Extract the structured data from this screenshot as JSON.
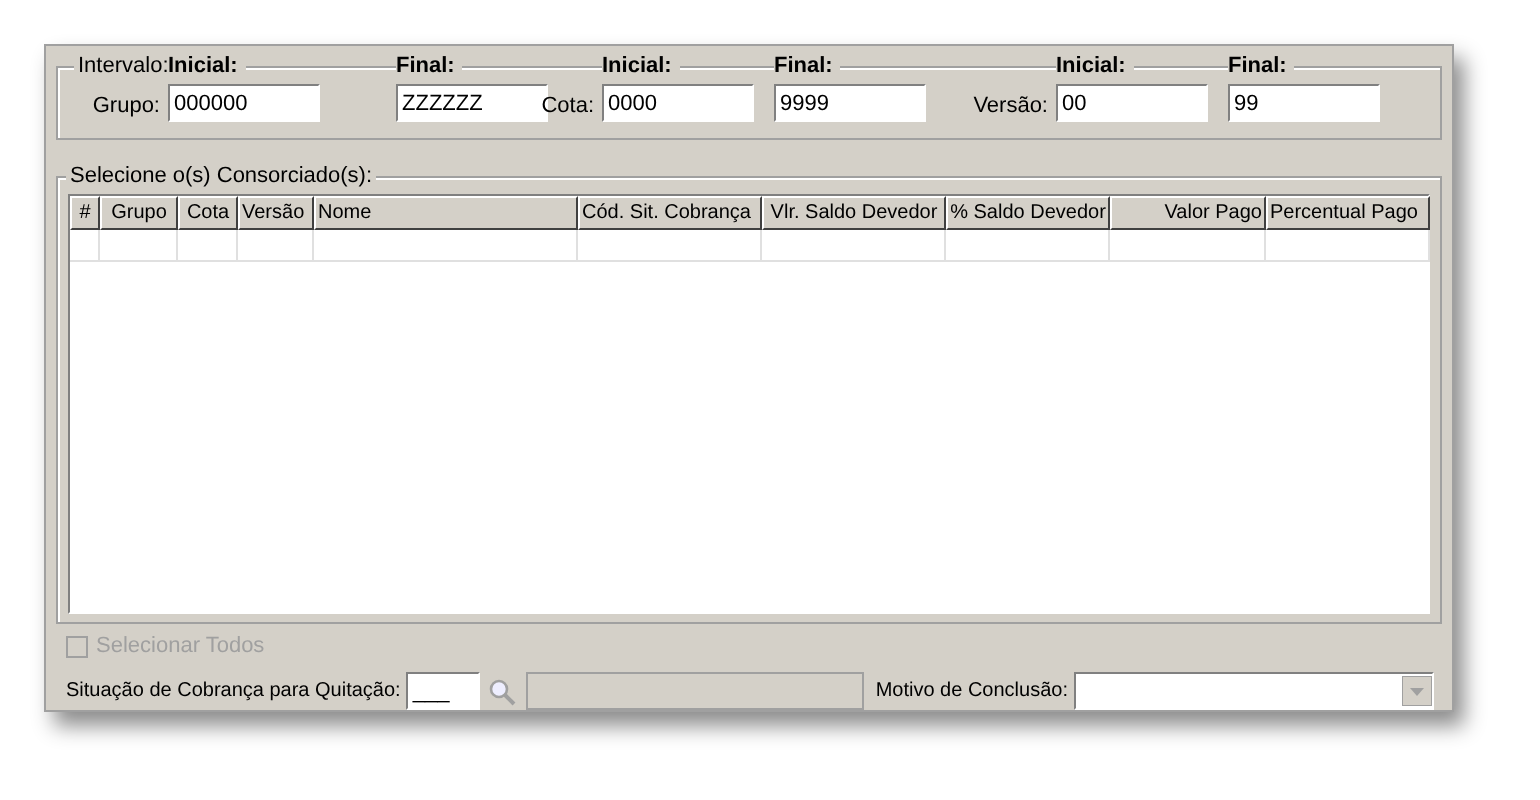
{
  "interval": {
    "legend": "Intervalo:",
    "fields": [
      {
        "label": "Grupo:",
        "start_heading": "Inicial:",
        "start_value": "000000",
        "end_heading": "Final:",
        "end_value": "ZZZZZZ"
      },
      {
        "label": "Cota:",
        "start_heading": "Inicial:",
        "start_value": "0000",
        "end_heading": "Final:",
        "end_value": "9999"
      },
      {
        "label": "Versão:",
        "start_heading": "Inicial:",
        "start_value": "00",
        "end_heading": "Final:",
        "end_value": "99"
      }
    ]
  },
  "consorciados": {
    "legend": "Selecione o(s) Consorciado(s):",
    "columns": [
      {
        "label": "#"
      },
      {
        "label": "Grupo"
      },
      {
        "label": "Cota"
      },
      {
        "label": "Versão"
      },
      {
        "label": "Nome"
      },
      {
        "label": "Cód. Sit. Cobrança"
      },
      {
        "label": "Vlr. Saldo Devedor"
      },
      {
        "label": "% Saldo Devedor"
      },
      {
        "label": "Valor Pago"
      },
      {
        "label": "Percentual Pago"
      }
    ],
    "select_all": {
      "label": "Selecionar Todos",
      "checked": false,
      "disabled": true
    }
  },
  "situacao": {
    "label": "Situação de Cobrança para Quitação:",
    "value": "___"
  },
  "motivo": {
    "label": "Motivo de Conclusão:"
  }
}
